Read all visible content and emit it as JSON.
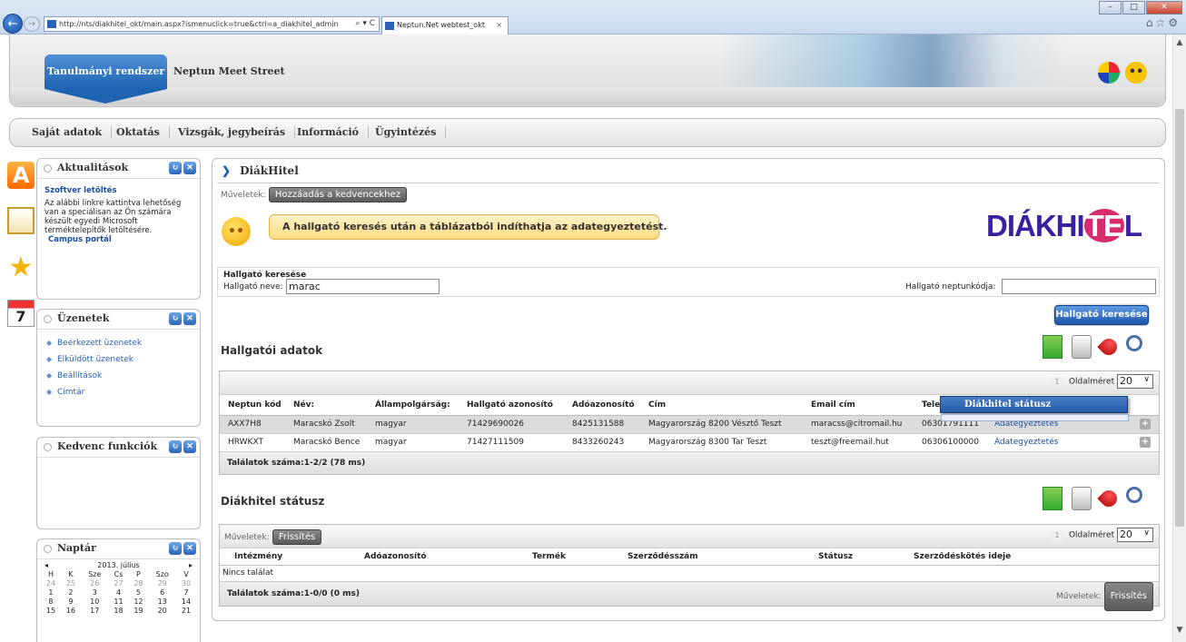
{
  "browser": {
    "url": "http://nts/diakhitel_okt/main.aspx?ismenuclick=true&ctrl=a_diakhitel_admin",
    "url_controls": "⌕ ▾ C",
    "tab_title": "Neptun.Net webtest_okt",
    "tab_close": "×",
    "back_icon": "←",
    "forward_icon": "→",
    "window_buttons": [
      "–",
      "□",
      "✕"
    ],
    "toolbar_icons": "⌂☆⚙"
  },
  "header": {
    "system_button": "Tanulmányi rendszer",
    "subtitle": "Neptun Meet Street"
  },
  "menu": {
    "items": [
      "Saját adatok",
      "Oktatás",
      "Vizsgák, jegybeírás",
      "Információ",
      "Ügyintézés"
    ]
  },
  "sidebar": {
    "news": {
      "title": "Aktualitások",
      "heading": "Szoftver letöltés",
      "body": "Az alábbi linkre kattintva lehetőség van a speciálisan az Ön számára készült egyedi Microsoft terméktelepítők letöltésére.",
      "link": "Campus portál"
    },
    "messages": {
      "title": "Üzenetek",
      "items": [
        "Beérkezett üzenetek",
        "Elküldött üzenetek",
        "Beállítások",
        "Címtár"
      ]
    },
    "favorites": {
      "title": "Kedvenc funkciók"
    },
    "calendar": {
      "title": "Naptár",
      "month": "2013. július",
      "prev": "◂",
      "next": "▸",
      "day_headers": [
        "H",
        "K",
        "Sze",
        "Cs",
        "P",
        "Szo",
        "V"
      ],
      "weeks": [
        [
          "24",
          "25",
          "26",
          "27",
          "28",
          "29",
          "30"
        ],
        [
          "1",
          "2",
          "3",
          "4",
          "5",
          "6",
          "7"
        ],
        [
          "8",
          "9",
          "10",
          "11",
          "12",
          "13",
          "14"
        ],
        [
          "15",
          "16",
          "17",
          "18",
          "19",
          "20",
          "21"
        ]
      ]
    },
    "panel_buttons": [
      "↻",
      "✕"
    ]
  },
  "main": {
    "title": "DiákHitel",
    "title_arrow": "❯",
    "ops_label": "Műveletek:",
    "add_favorite": "Hozzáadás a kedvencekhez",
    "hint": "A hallgató keresés után a táblázatból indíthatja az adategyeztetést.",
    "logo_text": [
      "DIÁKHI",
      "TE",
      "L"
    ],
    "search": {
      "title": "Hallgató keresése",
      "name_label": "Hallgató neve:",
      "name_value": "marac",
      "code_label": "Hallgató neptunkódja:",
      "code_value": "",
      "button": "Hallgató keresése"
    },
    "students": {
      "title": "Hallgatói adatok",
      "page_num": "1",
      "page_size_label": "Oldalméret",
      "page_size": "20",
      "columns": [
        "Neptun kód",
        "Név:",
        "Állampolgárság:",
        "Hallgató azonosító",
        "Adóazonosító",
        "Cím",
        "Email cím",
        "Tele",
        "",
        ""
      ],
      "rows": [
        [
          "AXX7H8",
          "Maracskó Zsolt",
          "magyar",
          "71429690026",
          "8425131588",
          "Magyarország 8200 Vésztő Teszt",
          "maracss@citromail.hu",
          "06301791111",
          "Adategyeztetés",
          "+"
        ],
        [
          "HRWKXT",
          "Maracskó Bence",
          "magyar",
          "71427111509",
          "8433260243",
          "Magyarország 8300 Tar Teszt",
          "teszt@freemail.hut",
          "06306100000",
          "Adategyeztetés",
          "+"
        ]
      ],
      "footer": "Találatok száma:1-2/2 (78 ms)"
    },
    "context_menu_item": "Diákhitel státusz",
    "status": {
      "title": "Diákhitel státusz",
      "ops_label": "Műveletek:",
      "refresh": "Frissítés",
      "page_num": "1",
      "page_size_label": "Oldalméret",
      "page_size": "20",
      "columns": [
        "Intézmény",
        "Adóazonosító",
        "Termék",
        "Szerződésszám",
        "Státusz",
        "Szerződéskötés ideje"
      ],
      "empty": "Nincs találat",
      "footer": "Találatok száma:1-0/0 (0 ms)",
      "footer_ops_label": "Műveletek:",
      "footer_refresh": "Frissítés"
    }
  },
  "colors": {
    "accent": "#1e63b2",
    "logo": "#3a1fa0",
    "logo_highlight": "#d62c6e"
  }
}
